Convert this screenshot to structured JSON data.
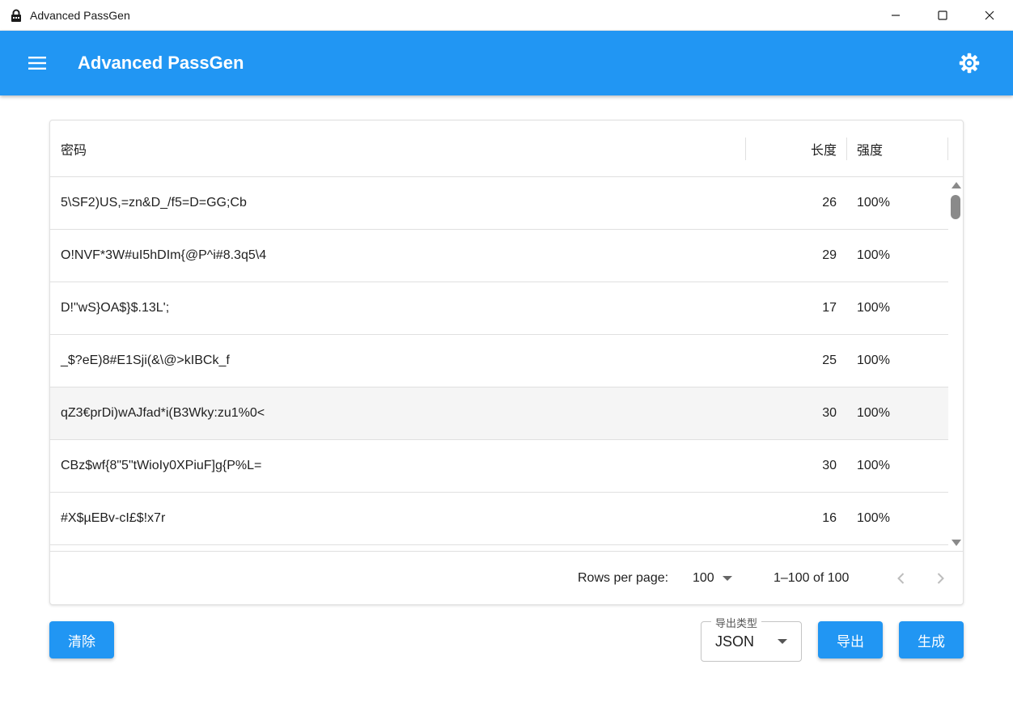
{
  "window": {
    "title": "Advanced PassGen",
    "controls": [
      "minimize-icon",
      "maximize-icon",
      "close-icon"
    ]
  },
  "appbar": {
    "title": "Advanced PassGen",
    "menu_icon": "menu-icon",
    "settings_icon": "gear-icon",
    "color": "#2196f3"
  },
  "table": {
    "headers": {
      "password": "密码",
      "length": "长度",
      "strength": "强度"
    },
    "rows": [
      {
        "password": "5\\SF2)US,=zn&D_/f5=D=GG;Cb",
        "length": "26",
        "strength": "100%"
      },
      {
        "password": "O!NVF*3W#uI5hDIm{@P^i#8.3q5\\4",
        "length": "29",
        "strength": "100%"
      },
      {
        "password": "D!\"wS}OA$}$.13L';",
        "length": "17",
        "strength": "100%"
      },
      {
        "password": "_$?eE)8#E1Sji(&\\@>kIBCk_f",
        "length": "25",
        "strength": "100%"
      },
      {
        "password": "qZ3€prDi)wAJfad*i(B3Wky:zu1%0<",
        "length": "30",
        "strength": "100%"
      },
      {
        "password": "CBz$wf{8\"5\"tWioIy0XPiuF]g{P%L=",
        "length": "30",
        "strength": "100%"
      },
      {
        "password": "#X$µEBv-cI£$!x7r",
        "length": "16",
        "strength": "100%"
      },
      {
        "password": "",
        "length": "",
        "strength": ""
      }
    ],
    "highlighted_row": 4,
    "footer": {
      "rows_per_page_label": "Rows per page:",
      "rows_per_page_value": "100",
      "range_text": "1–100 of 100"
    }
  },
  "actions": {
    "clear_label": "清除",
    "export_type_legend": "导出类型",
    "export_type_value": "JSON",
    "export_label": "导出",
    "generate_label": "生成"
  }
}
